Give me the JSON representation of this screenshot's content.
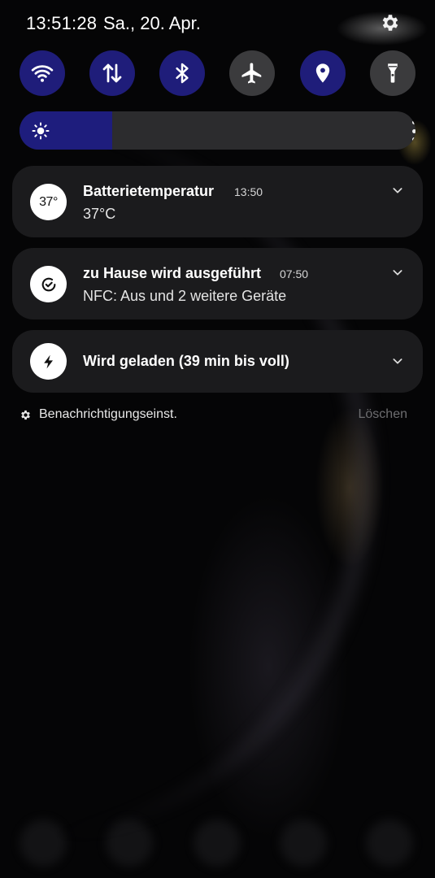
{
  "status_bar": {
    "time": "13:51:28",
    "date": "Sa., 20. Apr."
  },
  "quick_settings": [
    {
      "name": "wifi",
      "icon": "wifi-icon",
      "active": true
    },
    {
      "name": "mobile-data",
      "icon": "data-transfer-icon",
      "active": true
    },
    {
      "name": "bluetooth",
      "icon": "bluetooth-icon",
      "active": true
    },
    {
      "name": "airplane-mode",
      "icon": "airplane-icon",
      "active": false
    },
    {
      "name": "location",
      "icon": "location-pin-icon",
      "active": true
    },
    {
      "name": "flashlight",
      "icon": "flashlight-icon",
      "active": false
    }
  ],
  "brightness": {
    "level": 0.235,
    "icon": "sun-icon"
  },
  "notifications": [
    {
      "title": "Batterietemperatur",
      "time": "13:50",
      "body": "37°C",
      "icon_text": "37°",
      "icon": "temperature-icon"
    },
    {
      "title": "zu Hause wird ausgeführt",
      "time": "07:50",
      "body": "NFC: Aus und 2 weitere Geräte",
      "icon": "routine-check-icon"
    },
    {
      "title": "Wird geladen (39 min bis voll)",
      "icon": "charging-bolt-icon"
    }
  ],
  "footer": {
    "settings_label": "Benachrichtigungseinst.",
    "clear_label": "Löschen"
  },
  "colors": {
    "active_tile": "#1f1d7a",
    "inactive_tile": "#3b3b3d",
    "card": "#1b1b1d",
    "muted_text": "#6d6d70"
  }
}
